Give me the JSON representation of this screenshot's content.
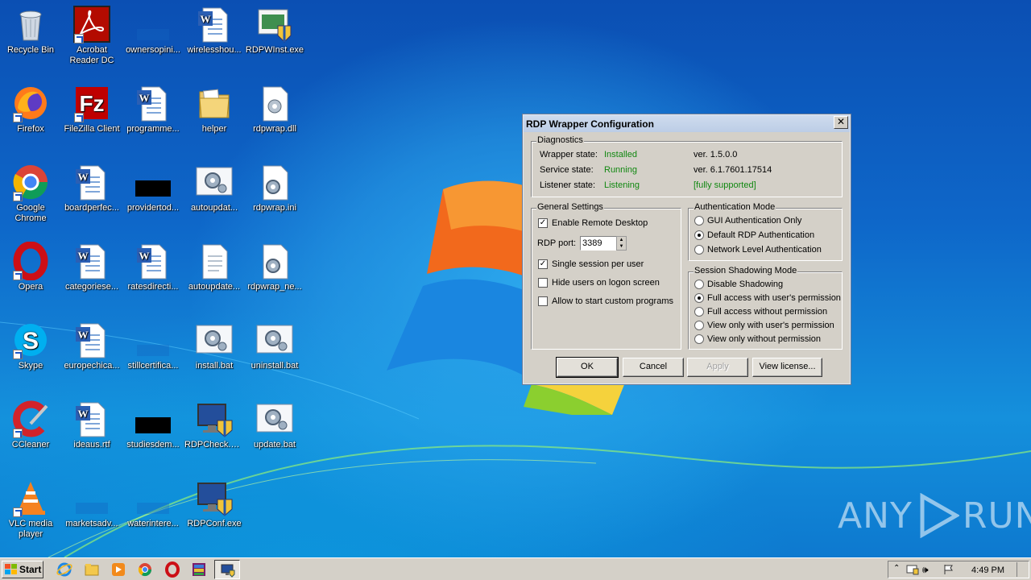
{
  "desktop": {
    "icons": [
      {
        "label": "Recycle Bin",
        "icon": "recycle-bin-icon"
      },
      {
        "label": "Acrobat Reader DC",
        "icon": "acrobat-icon"
      },
      {
        "label": "ownersopini...",
        "icon": "blank-file-icon"
      },
      {
        "label": "wirelesshou...",
        "icon": "word-doc-icon"
      },
      {
        "label": "RDPWInst.exe",
        "icon": "installer-icon"
      },
      {
        "label": "Firefox",
        "icon": "firefox-icon"
      },
      {
        "label": "FileZilla Client",
        "icon": "filezilla-icon"
      },
      {
        "label": "programme...",
        "icon": "word-doc-icon"
      },
      {
        "label": "helper",
        "icon": "folder-icon"
      },
      {
        "label": "rdpwrap.dll",
        "icon": "dll-icon"
      },
      {
        "label": "Google Chrome",
        "icon": "chrome-icon"
      },
      {
        "label": "boardperfec...",
        "icon": "word-doc-icon"
      },
      {
        "label": "providertod...",
        "icon": "black-thumb-icon"
      },
      {
        "label": "autoupdat...",
        "icon": "settings-file-icon"
      },
      {
        "label": "rdpwrap.ini",
        "icon": "ini-icon"
      },
      {
        "label": "Opera",
        "icon": "opera-icon"
      },
      {
        "label": "categoriese...",
        "icon": "word-doc-icon"
      },
      {
        "label": "ratesdirecti...",
        "icon": "word-doc-icon"
      },
      {
        "label": "autoupdate...",
        "icon": "text-file-icon"
      },
      {
        "label": "rdpwrap_ne...",
        "icon": "ini-icon"
      },
      {
        "label": "Skype",
        "icon": "skype-icon"
      },
      {
        "label": "europechica...",
        "icon": "word-doc-icon"
      },
      {
        "label": "stillcertifica...",
        "icon": "blank-file-icon"
      },
      {
        "label": "install.bat",
        "icon": "settings-file-icon"
      },
      {
        "label": "uninstall.bat",
        "icon": "settings-file-icon"
      },
      {
        "label": "CCleaner",
        "icon": "ccleaner-icon"
      },
      {
        "label": "ideaus.rtf",
        "icon": "word-doc-icon"
      },
      {
        "label": "studiesdem...",
        "icon": "black-thumb-icon"
      },
      {
        "label": "RDPCheck.exe",
        "icon": "monitor-shield-icon"
      },
      {
        "label": "update.bat",
        "icon": "settings-file-icon"
      },
      {
        "label": "VLC media player",
        "icon": "vlc-icon"
      },
      {
        "label": "marketsadv...",
        "icon": "blank-file-icon"
      },
      {
        "label": "waterintere...",
        "icon": "blank-file-icon"
      },
      {
        "label": "RDPConf.exe",
        "icon": "monitor-shield-icon"
      }
    ]
  },
  "dialog": {
    "title": "RDP Wrapper Configuration",
    "close": "✕",
    "diagnostics": {
      "title": "Diagnostics",
      "wrapper_label": "Wrapper state:",
      "wrapper_value": "Installed",
      "wrapper_ver": "ver. 1.5.0.0",
      "service_label": "Service state:",
      "service_value": "Running",
      "service_ver": "ver. 6.1.7601.17514",
      "listener_label": "Listener state:",
      "listener_value": "Listening",
      "listener_support": "[fully supported]"
    },
    "general": {
      "title": "General Settings",
      "enable_rd": "Enable Remote Desktop",
      "enable_rd_checked": true,
      "port_label": "RDP port:",
      "port_value": "3389",
      "single_session": "Single session per user",
      "single_session_checked": true,
      "hide_users": "Hide users on logon screen",
      "hide_users_checked": false,
      "custom_programs": "Allow to start custom programs",
      "custom_programs_checked": false
    },
    "auth": {
      "title": "Authentication Mode",
      "options": [
        "GUI Authentication Only",
        "Default RDP Authentication",
        "Network Level Authentication"
      ],
      "selected": 1
    },
    "shadow": {
      "title": "Session Shadowing Mode",
      "options": [
        "Disable Shadowing",
        "Full access with user's permission",
        "Full access without permission",
        "View only with user's permission",
        "View only without permission"
      ],
      "selected": 1
    },
    "buttons": {
      "ok": "OK",
      "cancel": "Cancel",
      "apply": "Apply",
      "license": "View license..."
    }
  },
  "taskbar": {
    "start": "Start",
    "clock": "4:49 PM",
    "quicklaunch": [
      "ie-icon",
      "explorer-icon",
      "media-player-icon",
      "chrome-icon",
      "opera-icon",
      "winrar-icon",
      "rdpconf-task-icon"
    ]
  },
  "watermark": {
    "left": "ANY",
    "right": "RUN"
  }
}
